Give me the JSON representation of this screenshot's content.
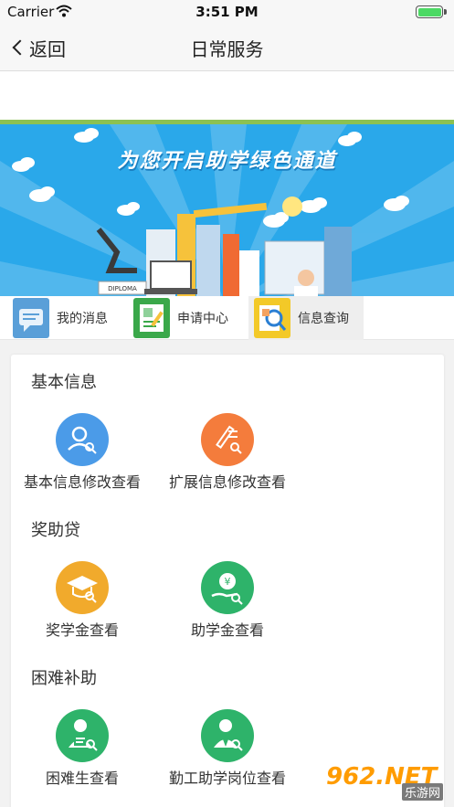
{
  "status_bar": {
    "carrier": "Carrier",
    "time": "3:51 PM",
    "battery_level": 1.0
  },
  "nav": {
    "back_label": "返回",
    "title": "日常服务"
  },
  "banner": {
    "slogan": "为您开启助学绿色通道",
    "diploma_text": "DIPLOMA"
  },
  "tabs": [
    {
      "label": "我的消息",
      "icon": "message-icon",
      "color": "#5a9fd8"
    },
    {
      "label": "申请中心",
      "icon": "application-form-icon",
      "color": "#3aa84a"
    },
    {
      "label": "信息查询",
      "icon": "info-search-icon",
      "color": "#f3c928"
    }
  ],
  "sections": [
    {
      "title": "基本信息",
      "items": [
        {
          "label": "基本信息修改查看",
          "icon": "user-search-icon",
          "color": "#4b9be8"
        },
        {
          "label": "扩展信息修改查看",
          "icon": "edit-search-icon",
          "color": "#f47c3c"
        }
      ]
    },
    {
      "title": "奖助贷",
      "items": [
        {
          "label": "奖学金查看",
          "icon": "graduation-cap-icon",
          "color": "#f1aa2c"
        },
        {
          "label": "助学金查看",
          "icon": "yuan-hand-icon",
          "color": "#2eb36a"
        }
      ]
    },
    {
      "title": "困难补助",
      "items": [
        {
          "label": "困难生查看",
          "icon": "hardship-student-icon",
          "color": "#2eb36a"
        },
        {
          "label": "勤工助学岗位查看",
          "icon": "work-study-icon",
          "color": "#2eb36a"
        }
      ]
    }
  ],
  "watermark": {
    "number": "962.NET",
    "subtitle": "乐游网"
  }
}
